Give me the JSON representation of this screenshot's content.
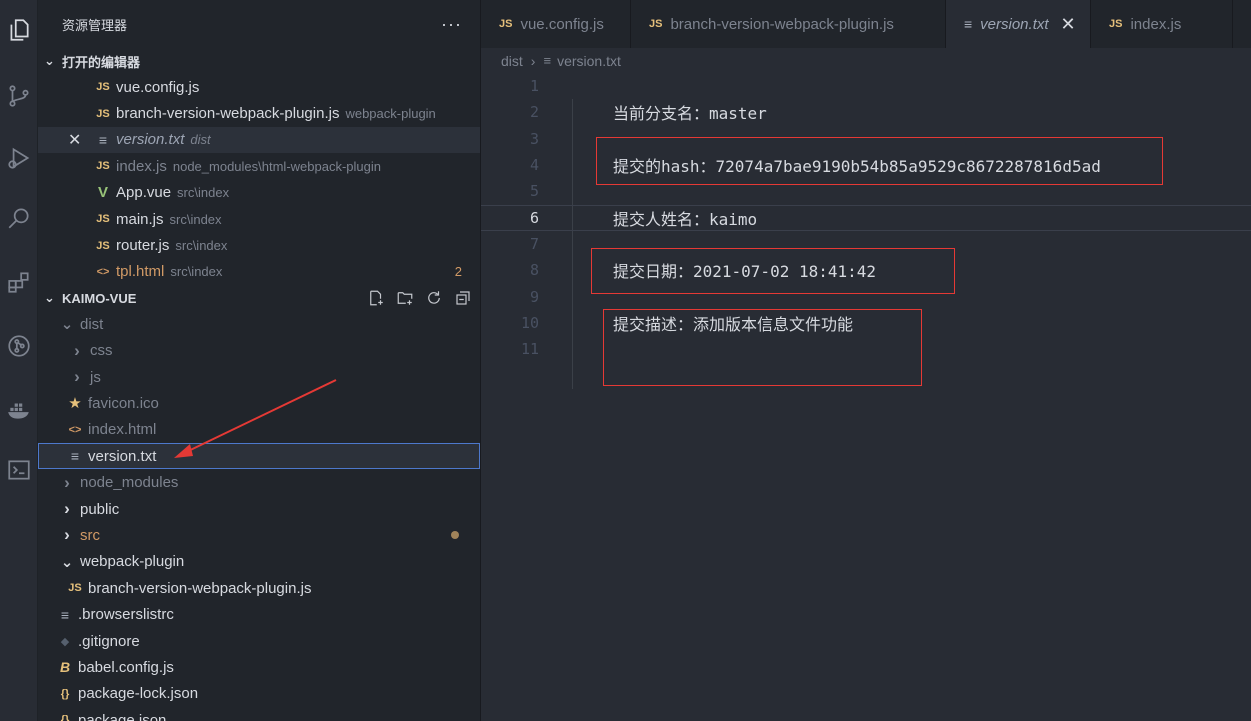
{
  "sidebar": {
    "title": "资源管理器",
    "more": "···",
    "open_editors": {
      "heading": "打开的编辑器",
      "items": [
        {
          "icon": "JS",
          "name": "vue.config.js",
          "sub": ""
        },
        {
          "icon": "JS",
          "name": "branch-version-webpack-plugin.js",
          "sub": "webpack-plugin"
        },
        {
          "icon": "≡",
          "name": "version.txt",
          "sub": "dist",
          "close": "✕"
        },
        {
          "icon": "JS",
          "name": "index.js",
          "sub": "node_modules\\html-webpack-plugin"
        },
        {
          "icon": "V",
          "name": "App.vue",
          "sub": "src\\index"
        },
        {
          "icon": "JS",
          "name": "main.js",
          "sub": "src\\index"
        },
        {
          "icon": "JS",
          "name": "router.js",
          "sub": "src\\index"
        },
        {
          "icon": "<>",
          "name": "tpl.html",
          "sub": "src\\index",
          "badge": "2"
        }
      ]
    },
    "project": {
      "heading": "KAIMO-VUE",
      "tree": [
        {
          "icon": "⌄",
          "name": "dist"
        },
        {
          "icon": "›",
          "name": "css"
        },
        {
          "icon": "›",
          "name": "js"
        },
        {
          "icon": "★",
          "name": "favicon.ico"
        },
        {
          "icon": "<>",
          "name": "index.html"
        },
        {
          "icon": "≡",
          "name": "version.txt"
        },
        {
          "icon": "›",
          "name": "node_modules"
        },
        {
          "icon": "›",
          "name": "public"
        },
        {
          "icon": "›",
          "name": "src"
        },
        {
          "icon": "⌄",
          "name": "webpack-plugin"
        },
        {
          "icon": "JS",
          "name": "branch-version-webpack-plugin.js"
        },
        {
          "icon": "≡",
          "name": ".browserslistrc"
        },
        {
          "icon": "◆",
          "name": ".gitignore"
        },
        {
          "icon": "B",
          "name": "babel.config.js"
        },
        {
          "icon": "{}",
          "name": "package-lock.json"
        },
        {
          "icon": "{}",
          "name": "package.json"
        }
      ]
    }
  },
  "tabs": [
    {
      "icon": "JS",
      "label": "vue.config.js"
    },
    {
      "icon": "JS",
      "label": "branch-version-webpack-plugin.js"
    },
    {
      "icon": "≡",
      "label": "version.txt",
      "close": "✕"
    },
    {
      "icon": "JS",
      "label": "index.js"
    }
  ],
  "breadcrumb": {
    "folder": "dist",
    "sep": "›",
    "file": "version.txt"
  },
  "editor": {
    "lines": [
      {
        "n": "1",
        "text": ""
      },
      {
        "n": "2",
        "text": "当前分支名：master"
      },
      {
        "n": "3",
        "text": ""
      },
      {
        "n": "4",
        "text": "提交的hash：72074a7bae9190b54b85a9529c8672287816d5ad"
      },
      {
        "n": "5",
        "text": ""
      },
      {
        "n": "6",
        "text": "提交人姓名：kaimo"
      },
      {
        "n": "7",
        "text": ""
      },
      {
        "n": "8",
        "text": "提交日期：2021-07-02 18:41:42"
      },
      {
        "n": "9",
        "text": ""
      },
      {
        "n": "10",
        "text": "提交描述：添加版本信息文件功能"
      },
      {
        "n": "11",
        "text": ""
      }
    ]
  },
  "colors": {
    "highlight_box": "#e53935",
    "arrow": "#e53935"
  }
}
